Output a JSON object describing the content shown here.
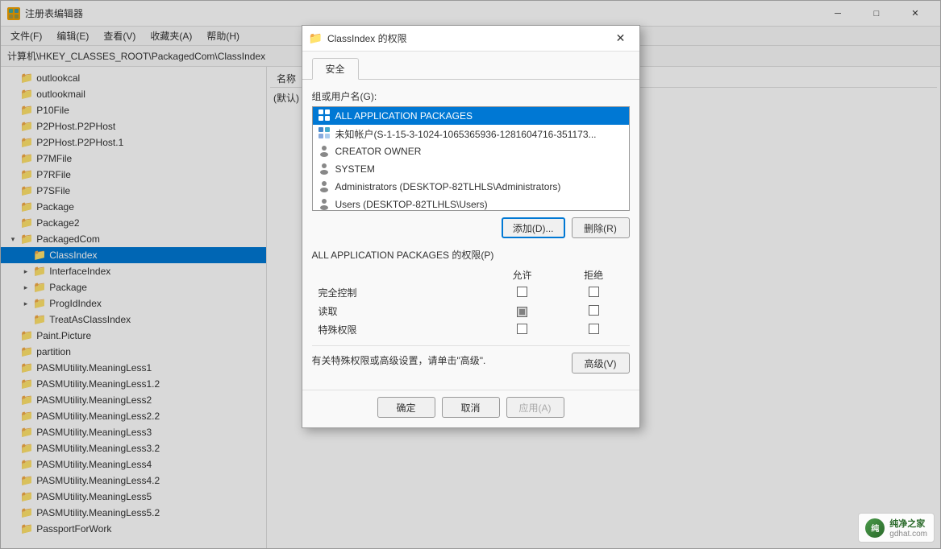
{
  "mainWindow": {
    "title": "注册表编辑器",
    "titleIcon": "🗂",
    "controls": {
      "minimize": "─",
      "maximize": "□",
      "close": "✕"
    }
  },
  "menuBar": {
    "items": [
      "文件(F)",
      "编辑(E)",
      "查看(V)",
      "收藏夹(A)",
      "帮助(H)"
    ]
  },
  "addressBar": {
    "label": "计算机\\HKEY_CLASSES_ROOT\\PackagedCom\\ClassIndex",
    "value": ""
  },
  "treeItems": [
    {
      "label": "outlookcal",
      "indent": 0,
      "expandable": false,
      "selected": false
    },
    {
      "label": "outlookmail",
      "indent": 0,
      "expandable": false,
      "selected": false
    },
    {
      "label": "P10File",
      "indent": 0,
      "expandable": false,
      "selected": false
    },
    {
      "label": "P2PHost.P2PHost",
      "indent": 0,
      "expandable": false,
      "selected": false
    },
    {
      "label": "P2PHost.P2PHost.1",
      "indent": 0,
      "expandable": false,
      "selected": false
    },
    {
      "label": "P7MFile",
      "indent": 0,
      "expandable": false,
      "selected": false
    },
    {
      "label": "P7RFile",
      "indent": 0,
      "expandable": false,
      "selected": false
    },
    {
      "label": "P7SFile",
      "indent": 0,
      "expandable": false,
      "selected": false
    },
    {
      "label": "Package",
      "indent": 0,
      "expandable": false,
      "selected": false
    },
    {
      "label": "Package2",
      "indent": 0,
      "expandable": false,
      "selected": false
    },
    {
      "label": "PackagedCom",
      "indent": 0,
      "expandable": true,
      "expanded": true,
      "selected": false
    },
    {
      "label": "ClassIndex",
      "indent": 1,
      "expandable": false,
      "selected": true
    },
    {
      "label": "InterfaceIndex",
      "indent": 1,
      "expandable": true,
      "selected": false
    },
    {
      "label": "Package",
      "indent": 1,
      "expandable": true,
      "selected": false
    },
    {
      "label": "ProgIdIndex",
      "indent": 1,
      "expandable": true,
      "selected": false
    },
    {
      "label": "TreatAsClassIndex",
      "indent": 1,
      "expandable": false,
      "selected": false
    },
    {
      "label": "Paint.Picture",
      "indent": 0,
      "expandable": false,
      "selected": false
    },
    {
      "label": "partition",
      "indent": 0,
      "expandable": false,
      "selected": false
    },
    {
      "label": "PASMUtility.MeaningLess1",
      "indent": 0,
      "expandable": false,
      "selected": false
    },
    {
      "label": "PASMUtility.MeaningLess1.2",
      "indent": 0,
      "expandable": false,
      "selected": false
    },
    {
      "label": "PASMUtility.MeaningLess2",
      "indent": 0,
      "expandable": false,
      "selected": false
    },
    {
      "label": "PASMUtility.MeaningLess2.2",
      "indent": 0,
      "expandable": false,
      "selected": false
    },
    {
      "label": "PASMUtility.MeaningLess3",
      "indent": 0,
      "expandable": false,
      "selected": false
    },
    {
      "label": "PASMUtility.MeaningLess3.2",
      "indent": 0,
      "expandable": false,
      "selected": false
    },
    {
      "label": "PASMUtility.MeaningLess4",
      "indent": 0,
      "expandable": false,
      "selected": false
    },
    {
      "label": "PASMUtility.MeaningLess4.2",
      "indent": 0,
      "expandable": false,
      "selected": false
    },
    {
      "label": "PASMUtility.MeaningLess5",
      "indent": 0,
      "expandable": false,
      "selected": false
    },
    {
      "label": "PASMUtility.MeaningLess5.2",
      "indent": 0,
      "expandable": false,
      "selected": false
    },
    {
      "label": "PassportForWork",
      "indent": 0,
      "expandable": false,
      "selected": false
    }
  ],
  "rightPanel": {
    "colName": "名称",
    "colDefault": "(默认)"
  },
  "dialog": {
    "title": "ClassIndex 的权限",
    "folderIcon": "📁",
    "closeBtn": "✕",
    "tabs": [
      {
        "label": "安全",
        "active": true
      }
    ],
    "groupLabel": "组或用户名(G):",
    "users": [
      {
        "label": "ALL APPLICATION PACKAGES",
        "selected": true,
        "iconType": "app"
      },
      {
        "label": "未知帐户(S-1-15-3-1024-1065365936-1281604716-351173...",
        "selected": false,
        "iconType": "app"
      },
      {
        "label": "CREATOR OWNER",
        "selected": false,
        "iconType": "user"
      },
      {
        "label": "SYSTEM",
        "selected": false,
        "iconType": "user"
      },
      {
        "label": "Administrators (DESKTOP-82TLHLS\\Administrators)",
        "selected": false,
        "iconType": "user"
      },
      {
        "label": "Users (DESKTOP-82TLHLS\\Users)",
        "selected": false,
        "iconType": "user"
      }
    ],
    "addBtn": "添加(D)...",
    "removeBtn": "删除(R)",
    "permLabel": "ALL APPLICATION PACKAGES 的权限(P)",
    "permColumns": [
      "允许",
      "拒绝"
    ],
    "permissions": [
      {
        "name": "完全控制",
        "allow": false,
        "deny": false,
        "allowGrayed": false,
        "denyGrayed": false
      },
      {
        "name": "读取",
        "allow": true,
        "deny": false,
        "allowGrayed": true,
        "denyGrayed": false
      },
      {
        "name": "特殊权限",
        "allow": false,
        "deny": false,
        "allowGrayed": false,
        "denyGrayed": false
      }
    ],
    "specialNote": "有关特殊权限或高级设置，请单击\"高级\".",
    "advancedBtn": "高级(V)",
    "confirmBtn": "确定",
    "cancelBtn": "取消",
    "applyBtn": "应用(A)"
  },
  "watermark": {
    "text": "纯净之家",
    "subtext": "gdhat.com"
  }
}
